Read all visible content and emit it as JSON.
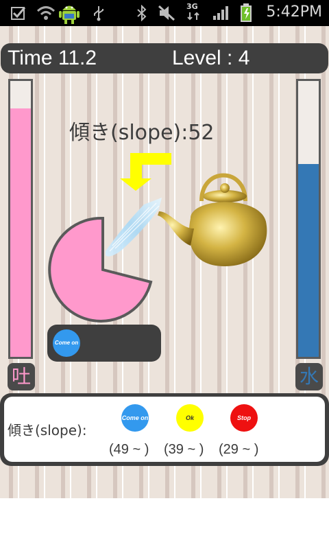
{
  "status_bar": {
    "icons": [
      "checkbox-icon",
      "wifi-icon",
      "android-icon",
      "usb-icon",
      "bluetooth-icon",
      "mute-icon",
      "3g-icon",
      "signal-icon",
      "battery-icon"
    ],
    "network": "3G",
    "time": "5:42PM"
  },
  "header": {
    "time_label": "Time 11.2",
    "level_label": "Level : 4"
  },
  "meters": {
    "left": {
      "fill_percent": 90,
      "color": "#ff99cc",
      "kanji": "吐",
      "kanji_color": "#ff99cc"
    },
    "right": {
      "fill_percent": 70,
      "color": "#3478b5",
      "kanji": "水",
      "kanji_color": "#3478b5"
    }
  },
  "slope_display": "傾き(slope):52",
  "pie": {
    "color": "#ff99cc",
    "border": "#5a5a5a"
  },
  "control": {
    "button_label": "Come on",
    "button_color": "#3399ee"
  },
  "legend": {
    "title": "傾き(slope):",
    "items": [
      {
        "label": "Come on",
        "color": "#3399ee",
        "range": "(49 ~ )"
      },
      {
        "label": "Ok",
        "color": "#ffff00",
        "range": "(39 ~ )"
      },
      {
        "label": "Stop",
        "color": "#ee1111",
        "range": "(29 ~ )"
      }
    ]
  },
  "colors": {
    "arrow": "#ffff00",
    "teapot": "#c9a63a",
    "water": "#a8d8f5"
  }
}
